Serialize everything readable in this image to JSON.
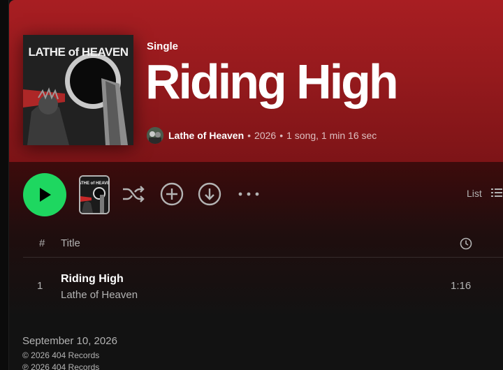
{
  "header": {
    "type_label": "Single",
    "title": "Riding High",
    "cover_text": "LATHE of HEAVEN",
    "artist": "Lathe of Heaven",
    "year": "2026",
    "summary": "1 song, 1 min 16 sec",
    "colors": {
      "header_top": "#a81e22",
      "header_bottom": "#7d1417"
    }
  },
  "controls": {
    "view_label": "List",
    "icons": [
      "play-icon",
      "shuffle-icon",
      "add-icon",
      "download-icon",
      "more-options-icon",
      "list-view-icon"
    ],
    "accent": "#1ed760"
  },
  "tracklist": {
    "header_num": "#",
    "header_title": "Title",
    "tracks": [
      {
        "num": "1",
        "title": "Riding High",
        "artist": "Lathe of Heaven",
        "duration": "1:16"
      }
    ]
  },
  "footer": {
    "release_date": "September 10, 2026",
    "copyright": "© 2026 404 Records",
    "phonographic": "℗ 2026 404 Records"
  }
}
